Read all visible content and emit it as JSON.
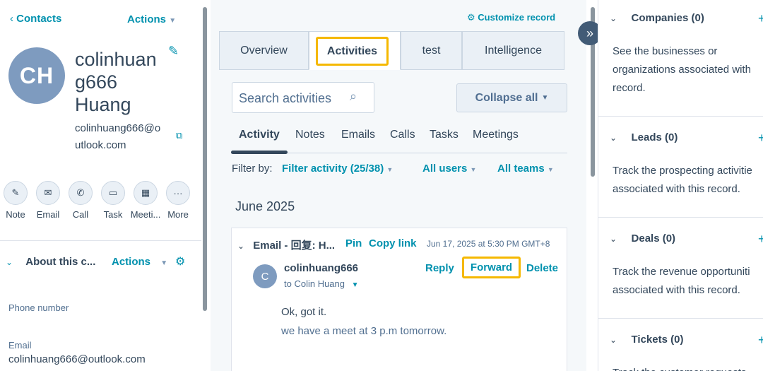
{
  "left": {
    "back_label": "Contacts",
    "actions_label": "Actions",
    "avatar_initials": "CH",
    "name_line1": "colinhuan",
    "name_line2": "g666",
    "name_line3": "Huang",
    "email_line1": "colinhuang666@o",
    "email_line2": "utlook.com",
    "quick_actions": [
      "Note",
      "Email",
      "Call",
      "Task",
      "Meeti...",
      "More"
    ],
    "about_title": "About this c...",
    "about_actions": "Actions",
    "phone_label": "Phone number",
    "email_label": "Email",
    "email_value": "colinhuang666@outlook.com"
  },
  "middle": {
    "customize_label": "Customize record",
    "tabs": [
      "Overview",
      "Activities",
      "test",
      "Intelligence"
    ],
    "search_placeholder": "Search activities",
    "collapse_label": "Collapse all",
    "subtabs": [
      "Activity",
      "Notes",
      "Emails",
      "Calls",
      "Tasks",
      "Meetings"
    ],
    "filter_by": "Filter by:",
    "filter_activity": "Filter activity (25/38)",
    "all_users": "All users",
    "all_teams": "All teams",
    "month": "June 2025",
    "card": {
      "title": "Email - 回复: H...",
      "pin": "Pin",
      "copy_link": "Copy link",
      "timestamp": "Jun 17, 2025 at 5:30 PM GMT+8",
      "sender_initial": "C",
      "sender": "colinhuang666",
      "to": "to Colin Huang",
      "reply": "Reply",
      "forward": "Forward",
      "delete": "Delete",
      "body1": "Ok, got it.",
      "body2": "we have a meet at 3 p.m tomorrow."
    }
  },
  "right": {
    "companies_title": "Companies (0)",
    "companies_text1": "See the businesses or",
    "companies_text2": "organizations associated with",
    "companies_text3": "record.",
    "leads_title": "Leads (0)",
    "leads_text1": "Track the prospecting activitie",
    "leads_text2": "associated with this record.",
    "deals_title": "Deals (0)",
    "deals_text1": "Track the revenue opportuniti",
    "deals_text2": "associated with this record.",
    "tickets_title": "Tickets (0)",
    "tickets_text1": "Track the customer requests"
  },
  "colors": {
    "accent": "#0091ae",
    "highlight": "#f5b800",
    "avatar": "#7e9bbf"
  }
}
